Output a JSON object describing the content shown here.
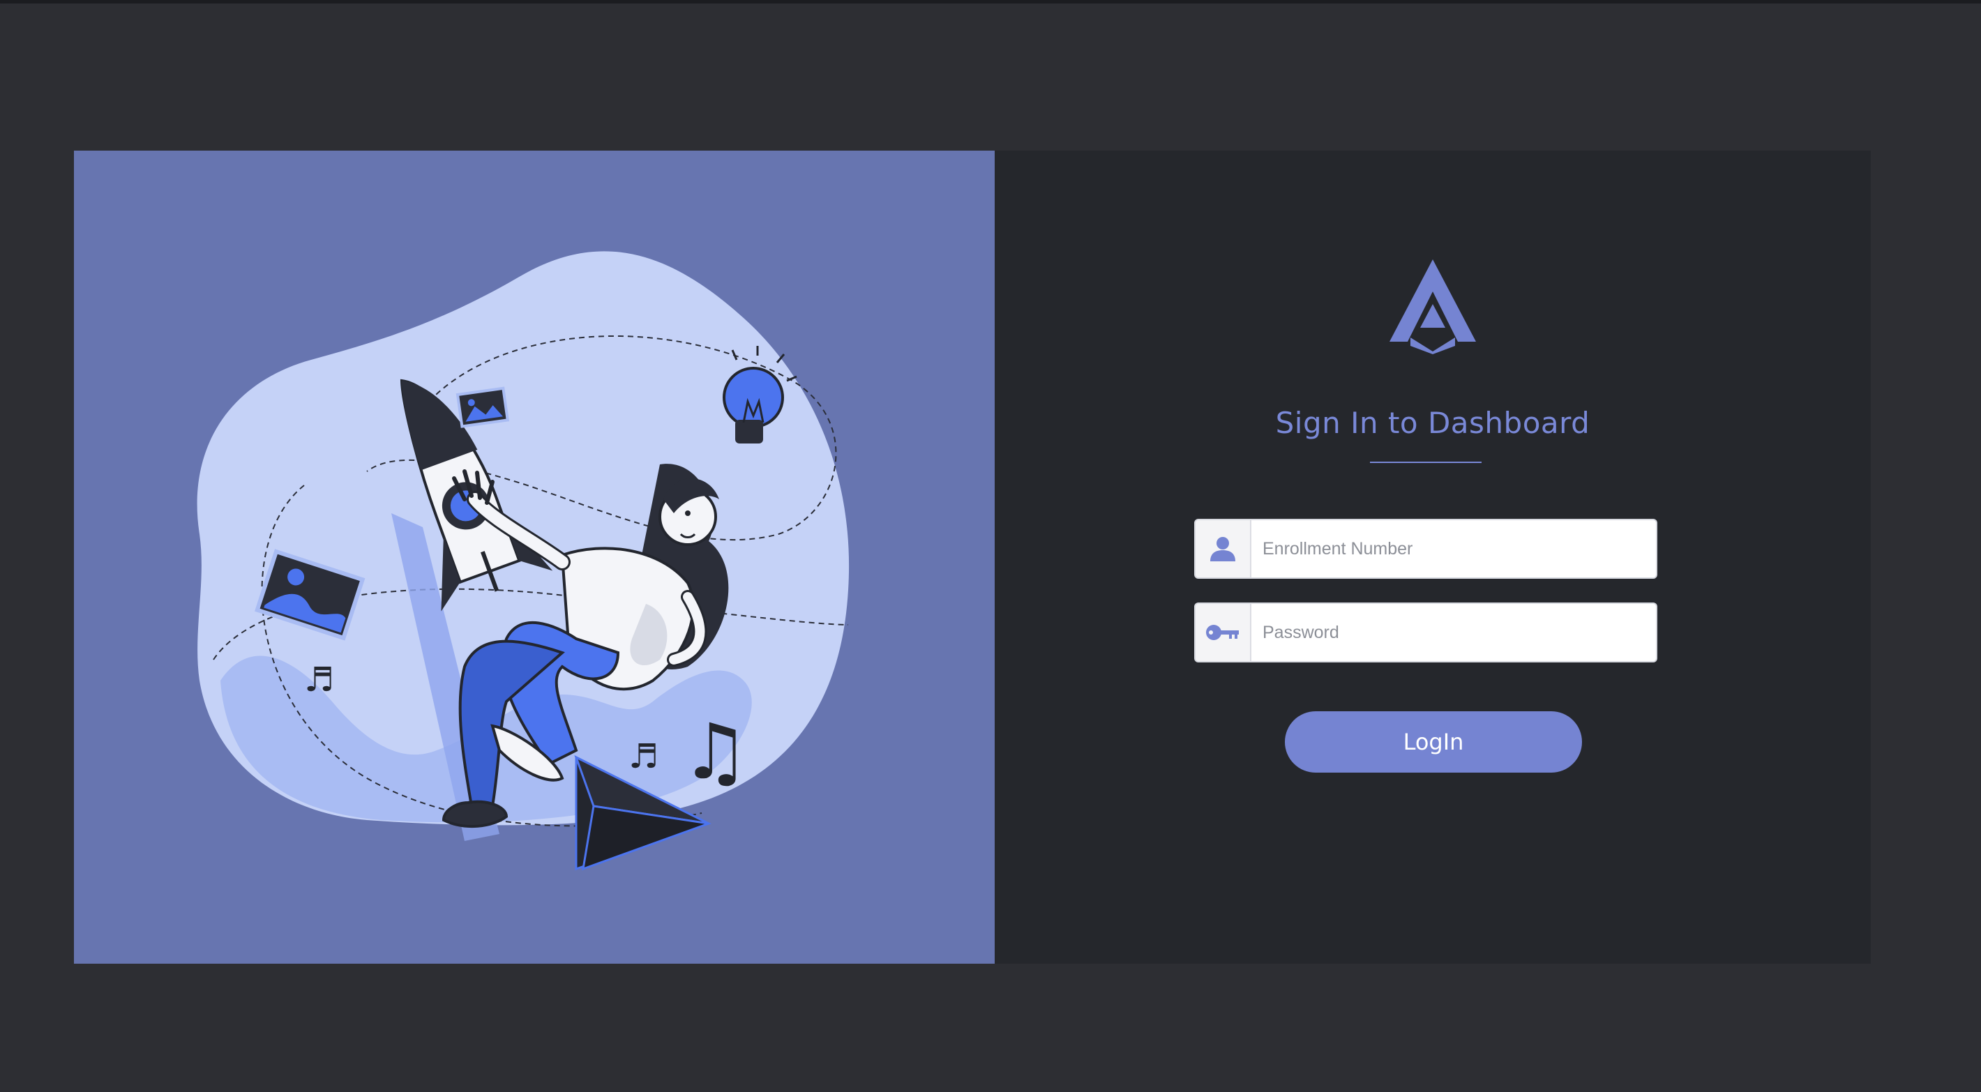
{
  "form": {
    "title": "Sign In to Dashboard",
    "enrollment": {
      "placeholder": "Enrollment Number",
      "value": "",
      "icon": "user-icon"
    },
    "password": {
      "placeholder": "Password",
      "value": "",
      "icon": "key-icon"
    },
    "login_label": "LogIn"
  },
  "brand": {
    "logo_icon": "brand-logo-icon",
    "accent_color": "#7584d2"
  },
  "illustration": {
    "icon": "astronaut-girl-rocket-illustration"
  }
}
